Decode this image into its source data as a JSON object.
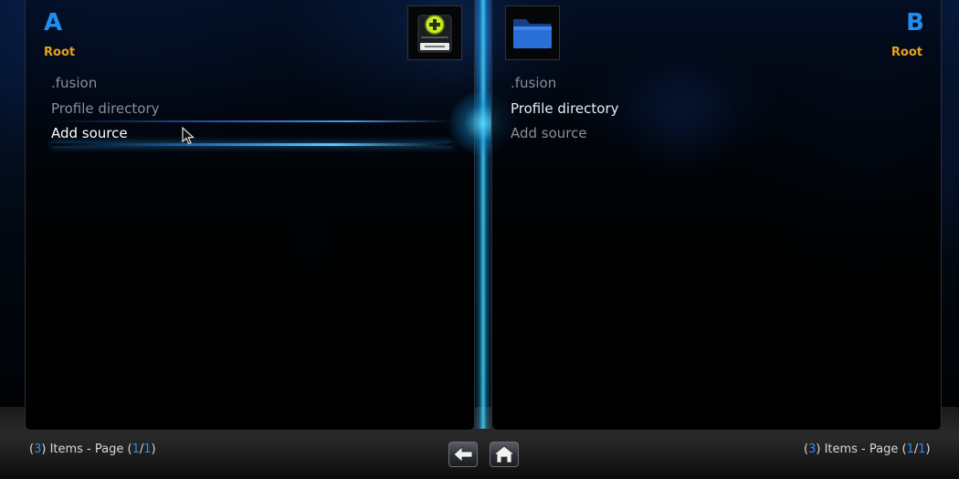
{
  "window": {
    "title": ""
  },
  "panes": [
    {
      "letter": "A",
      "path": "Root",
      "items": [
        ".fusion",
        "Profile directory",
        "Add source"
      ],
      "focused_index": 2,
      "thumbnail_icon": "add-source-drive-icon",
      "status": {
        "open": "(",
        "count": "3",
        "mid": ") Items - Page (",
        "page": "1",
        "slash": "/",
        "pages": "1",
        "close": ")"
      }
    },
    {
      "letter": "B",
      "path": "Root",
      "items": [
        ".fusion",
        "Profile directory",
        "Add source"
      ],
      "selected_index": 1,
      "thumbnail_icon": "folder-icon",
      "status": {
        "open": "(",
        "count": "3",
        "mid": ") Items - Page (",
        "page": "1",
        "slash": "/",
        "pages": "1",
        "close": ")"
      }
    }
  ],
  "footer": {
    "back_icon": "back-arrow-icon",
    "home_icon": "home-icon"
  },
  "colors": {
    "accent_blue": "#1e8ef0",
    "path_orange": "#e8a219",
    "item_dim": "#8a8f97",
    "item_active": "#ffffff"
  }
}
